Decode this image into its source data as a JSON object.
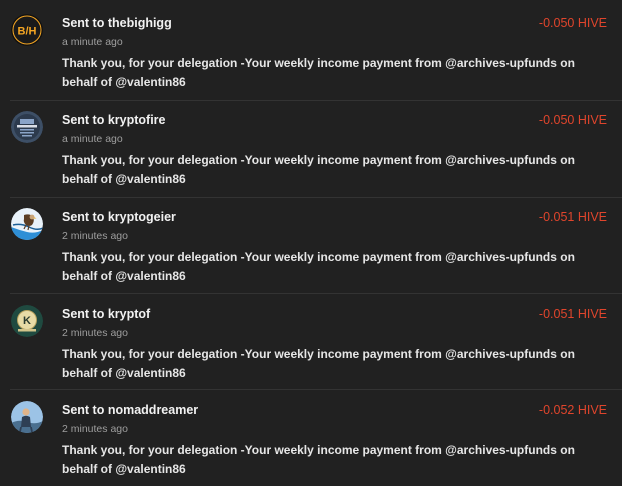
{
  "colors": {
    "background": "#212121",
    "divider": "#333333",
    "amount": "#e0452c",
    "title": "#f2f2f2",
    "time": "#9e9e9e"
  },
  "transactions": [
    {
      "title": "Sent to thebighigg",
      "time": "a minute ago",
      "memo": "Thank you, for your delegation -Your weekly income payment from @archives-upfunds on behalf of @valentin86",
      "amount": "-0.050 HIVE",
      "avatar": {
        "icon": "bh-logo-avatar",
        "text": "B/H"
      }
    },
    {
      "title": "Sent to kryptofire",
      "time": "a minute ago",
      "memo": "Thank you, for your delegation -Your weekly income payment from @archives-upfunds on behalf of @valentin86",
      "amount": "-0.050 HIVE",
      "avatar": {
        "icon": "kryptofire-logo-avatar"
      }
    },
    {
      "title": "Sent to kryptogeier",
      "time": "2 minutes ago",
      "memo": "Thank you, for your delegation -Your weekly income payment from @archives-upfunds on behalf of @valentin86",
      "amount": "-0.051 HIVE",
      "avatar": {
        "icon": "vulture-avatar"
      }
    },
    {
      "title": "Sent to kryptof",
      "time": "2 minutes ago",
      "memo": "Thank you, for your delegation -Your weekly income payment from @archives-upfunds on behalf of @valentin86",
      "amount": "-0.051 HIVE",
      "avatar": {
        "icon": "kryptof-coin-avatar",
        "text": "K"
      }
    },
    {
      "title": "Sent to nomaddreamer",
      "time": "2 minutes ago",
      "memo": "Thank you, for your delegation -Your weekly income payment from @archives-upfunds on behalf of @valentin86",
      "amount": "-0.052 HIVE",
      "avatar": {
        "icon": "person-photo-avatar"
      }
    }
  ]
}
